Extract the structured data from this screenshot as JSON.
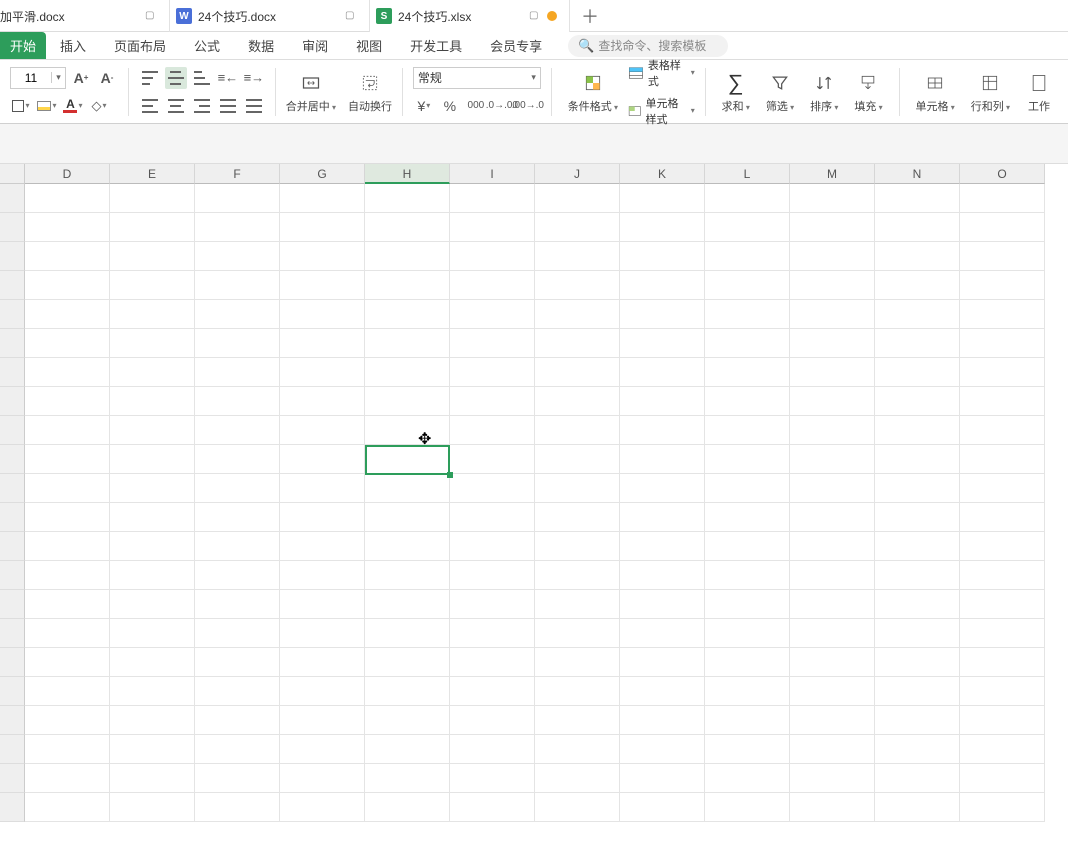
{
  "tabs": [
    {
      "name": "加平滑.docx",
      "icon": null
    },
    {
      "name": "24个技巧.docx",
      "icon": "W"
    },
    {
      "name": "24个技巧.xlsx",
      "icon": "S",
      "active": true
    }
  ],
  "menubar": [
    "开始",
    "插入",
    "页面布局",
    "公式",
    "数据",
    "审阅",
    "视图",
    "开发工具",
    "会员专享"
  ],
  "search_placeholder": "查找命令、搜索模板",
  "font_size": "11",
  "number_format": "常规",
  "ribbon_mid": {
    "merge": "合并居中",
    "wrap": "自动换行"
  },
  "style_group": {
    "cond": "条件格式",
    "table": "表格样式",
    "cell": "单元格样式"
  },
  "tool_group": {
    "sum": "求和",
    "filter": "筛选",
    "sort": "排序",
    "fill": "填充"
  },
  "cell_group": {
    "cells": "单元格",
    "rowcol": "行和列",
    "work": "工作"
  },
  "columns": [
    "D",
    "E",
    "F",
    "G",
    "H",
    "I",
    "J",
    "K",
    "L",
    "M",
    "N",
    "O"
  ],
  "selected_column": "H",
  "selected_cell": {
    "col": "H",
    "row": 10
  },
  "grid_rows": 22
}
